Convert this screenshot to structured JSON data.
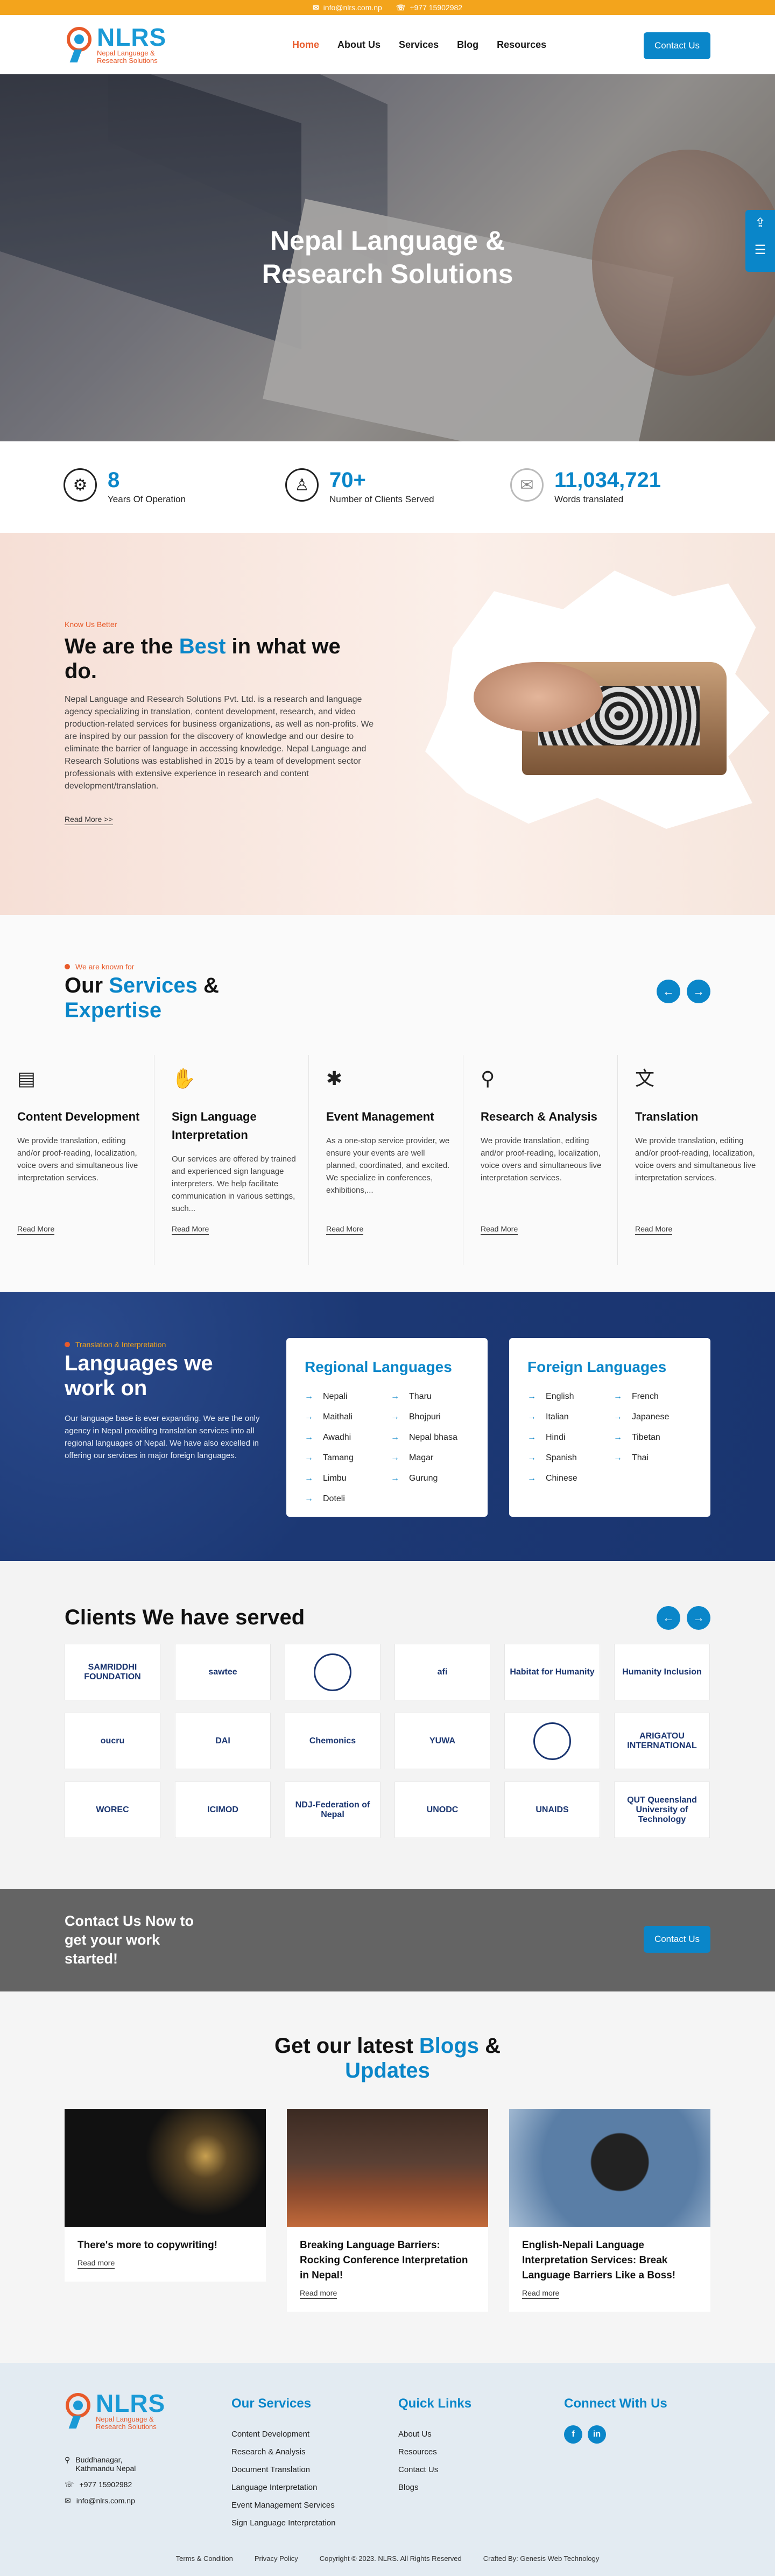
{
  "topbar": {
    "email": "info@nlrs.com.np",
    "phone": "+977 15902982"
  },
  "brand": {
    "name": "NLRS",
    "tagline_1": "Nepal Language &",
    "tagline_2": "Research Solutions"
  },
  "nav": {
    "items": [
      "Home",
      "About Us",
      "Services",
      "Blog",
      "Resources"
    ],
    "cta": "Contact Us"
  },
  "hero": {
    "title_1": "Nepal Language &",
    "title_2": "Research Solutions"
  },
  "stats": [
    {
      "value": "8",
      "label": "Years Of Operation",
      "icon": "gear-icon"
    },
    {
      "value": "70+",
      "label": "Number of Clients Served",
      "icon": "handshake-icon"
    },
    {
      "value": "11,034,721",
      "label": "Words translated",
      "icon": "translate-icon"
    }
  ],
  "about": {
    "eyebrow": "Know Us Better",
    "title_a": "We are the ",
    "title_b": "Best",
    "title_c": " in what we do.",
    "body": "Nepal Language and Research Solutions Pvt. Ltd. is a research and language agency specializing in translation, content development, research, and video production-related services for business organizations, as well as non-profits. We are inspired by our passion for the discovery of knowledge and our desire to eliminate the barrier of language in accessing knowledge. Nepal Language and Research Solutions was established in 2015 by a team of development sector professionals with extensive experience in research and content development/translation.",
    "read": "Read More >>"
  },
  "services": {
    "eyebrow": "We are known for",
    "title_a": "Our ",
    "title_b": "Services",
    "title_c": " & ",
    "title_d": "Expertise",
    "items": [
      {
        "title": "Content Development",
        "body": "We provide translation, editing and/or proof-reading, localization, voice overs and simultaneous live interpretation services.",
        "read": "Read More",
        "icon": "document-icon"
      },
      {
        "title": "Sign Language Interpretation",
        "body": "Our services are offered by trained and experienced sign language interpreters. We help facilitate communication in various settings, such...",
        "read": "Read More",
        "icon": "sign-language-icon"
      },
      {
        "title": "Event Management",
        "body": "As a one-stop service provider, we ensure your events are well planned, coordinated, and excited. We specialize in conferences, exhibitions,...",
        "read": "Read More",
        "icon": "event-icon"
      },
      {
        "title": "Research & Analysis",
        "body": "We provide translation, editing and/or proof-reading, localization, voice overs and simultaneous live interpretation services.",
        "read": "Read More",
        "icon": "research-icon"
      },
      {
        "title": "Translation",
        "body": "We provide translation, editing and/or proof-reading, localization, voice overs and simultaneous live interpretation services.",
        "read": "Read More",
        "icon": "translate-icon"
      }
    ]
  },
  "languages": {
    "eyebrow": "Translation & Interpretation",
    "title": "Languages we work on",
    "body": "Our language base is ever expanding. We are the only agency in Nepal providing translation services into all regional languages of Nepal. We have also excelled in offering our services in major foreign languages.",
    "regional": {
      "title": "Regional Languages",
      "col1": [
        "Nepali",
        "Maithali",
        "Awadhi",
        "Tamang",
        "Limbu",
        "Doteli"
      ],
      "col2": [
        "Tharu",
        "Bhojpuri",
        "Nepal bhasa",
        "Magar",
        "Gurung"
      ]
    },
    "foreign": {
      "title": "Foreign Languages",
      "col1": [
        "English",
        "Italian",
        "Hindi",
        "Spanish",
        "Chinese"
      ],
      "col2": [
        "French",
        "Japanese",
        "Tibetan",
        "Thai"
      ]
    }
  },
  "clients": {
    "title": "Clients We have served",
    "logos": [
      "SAMRIDDHI FOUNDATION",
      "sawtee",
      "",
      "afi",
      "Habitat for Humanity",
      "Humanity Inclusion",
      "oucru",
      "DAI",
      "Chemonics",
      "YUWA",
      "",
      "ARIGATOU INTERNATIONAL",
      "WOREC",
      "ICIMOD",
      "NDJ-Federation of Nepal",
      "UNODC",
      "UNAIDS",
      "QUT Queensland University of Technology"
    ]
  },
  "cta": {
    "line1": "Contact Us Now to",
    "line2": "get your work",
    "line3": "started!",
    "button": "Contact Us"
  },
  "blogs": {
    "title_a": "Get our latest ",
    "title_b": "Blogs",
    "title_c": " & ",
    "title_d": "Updates",
    "items": [
      {
        "title": "There's more to copywriting!",
        "read": "Read more"
      },
      {
        "title": "Breaking Language Barriers: Rocking Conference Interpretation in Nepal!",
        "read": "Read more"
      },
      {
        "title": "English-Nepali Language Interpretation Services: Break Language Barriers Like a Boss!",
        "read": "Read more"
      }
    ]
  },
  "footer": {
    "address": "Buddhanagar, Kathmandu Nepal",
    "phone": "+977 15902982",
    "email": "info@nlrs.com.np",
    "services_title": "Our Services",
    "services": [
      "Content Development",
      "Research & Analysis",
      "Document Translation",
      "Language Interpretation",
      "Event Management Services",
      "Sign Language Interpretation"
    ],
    "links_title": "Quick Links",
    "links": [
      "About Us",
      "Resources",
      "Contact Us",
      "Blogs"
    ],
    "connect_title": "Connect With Us",
    "bottom": [
      "Terms & Condition",
      "Privacy Policy",
      "Copyright © 2023. NLRS. All Rights Reserved",
      "Crafted By: Genesis Web Technology"
    ]
  },
  "colors": {
    "accent": "#0a86c9",
    "orange": "#e85a2a",
    "topbar": "#f3a41c",
    "navy": "#1c3874"
  }
}
